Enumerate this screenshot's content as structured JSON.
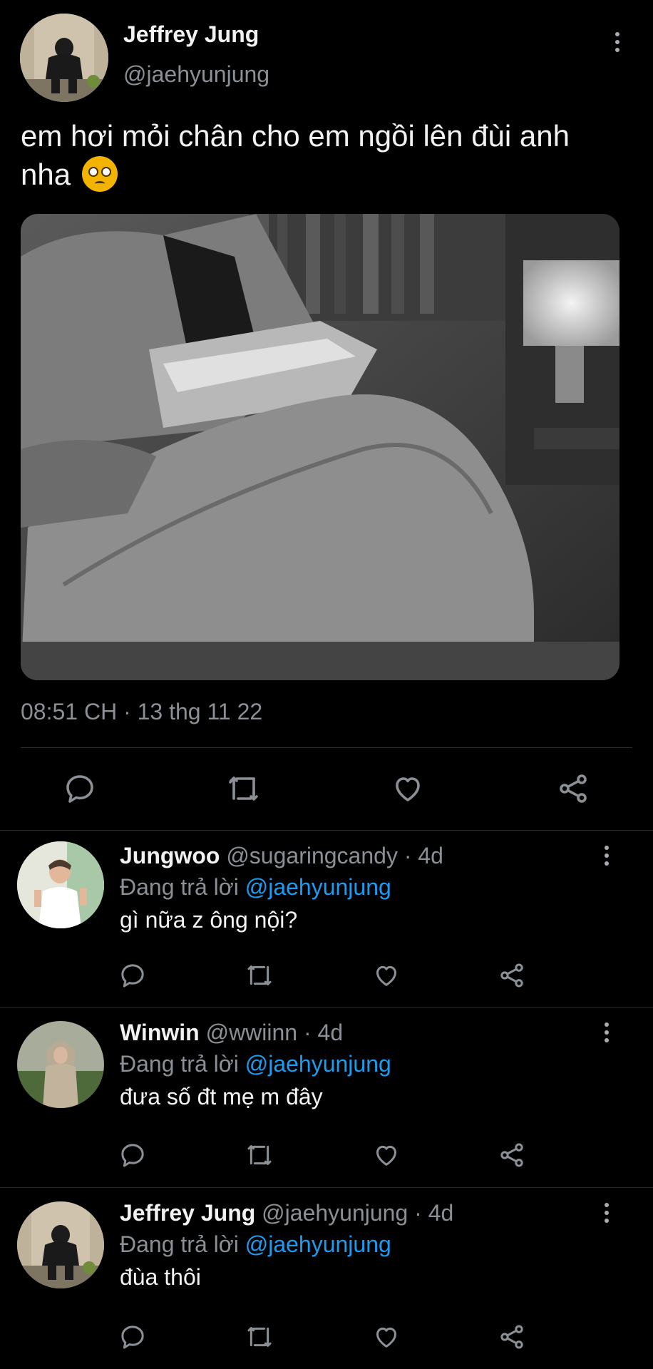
{
  "main_tweet": {
    "author_name": "Jeffrey Jung",
    "author_handle": "@jaehyunjung",
    "text": "em hơi mỏi chân cho em ngồi lên đùi anh nha",
    "emoji": "pleading-face",
    "timestamp": "08:51 CH · 13 thg 11 22",
    "actions": [
      "reply-icon",
      "retweet-icon",
      "like-icon",
      "share-icon"
    ]
  },
  "replies": [
    {
      "name": "Jungwoo",
      "handle": "@sugaringcandy",
      "time": "· 4d",
      "replying_prefix": "Đang trả lời",
      "replying_to": "@jaehyunjung",
      "text": "gì nữa z ông nội?"
    },
    {
      "name": "Winwin",
      "handle": "@wwiinn",
      "time": "· 4d",
      "replying_prefix": "Đang trả lời",
      "replying_to": "@jaehyunjung",
      "text": "đưa số đt mẹ m đây"
    },
    {
      "name": "Jeffrey Jung",
      "handle": "@jaehyunjung",
      "time": "· 4d",
      "replying_prefix": "Đang trả lời",
      "replying_to": "@jaehyunjung",
      "text": "đùa thôi"
    }
  ],
  "colors": {
    "background": "#000000",
    "text": "#f2f2f2",
    "secondary": "#8b9096",
    "mention": "#1d9bf0",
    "divider": "#2a2d30"
  }
}
